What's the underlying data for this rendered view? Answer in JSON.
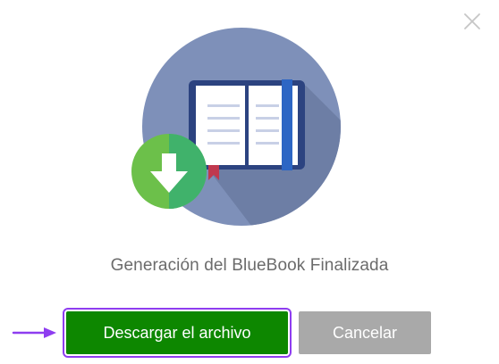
{
  "dialog": {
    "message": "Generación del BlueBook Finalizada",
    "icons": {
      "close": "close-icon",
      "illustration": "book-download-illustration",
      "book": "open-book-icon",
      "download": "download-arrow-icon",
      "pointer": "arrow-pointer-icon"
    },
    "buttons": {
      "download_label": "Descargar el archivo",
      "cancel_label": "Cancelar"
    },
    "colors": {
      "download_button": "#0d8700",
      "cancel_button": "#a9a9a9",
      "highlight": "#8e3df0",
      "illustration_circle": "#7e90b9",
      "download_badge": "#6cc04a",
      "message_text": "#6b6b6b"
    }
  }
}
